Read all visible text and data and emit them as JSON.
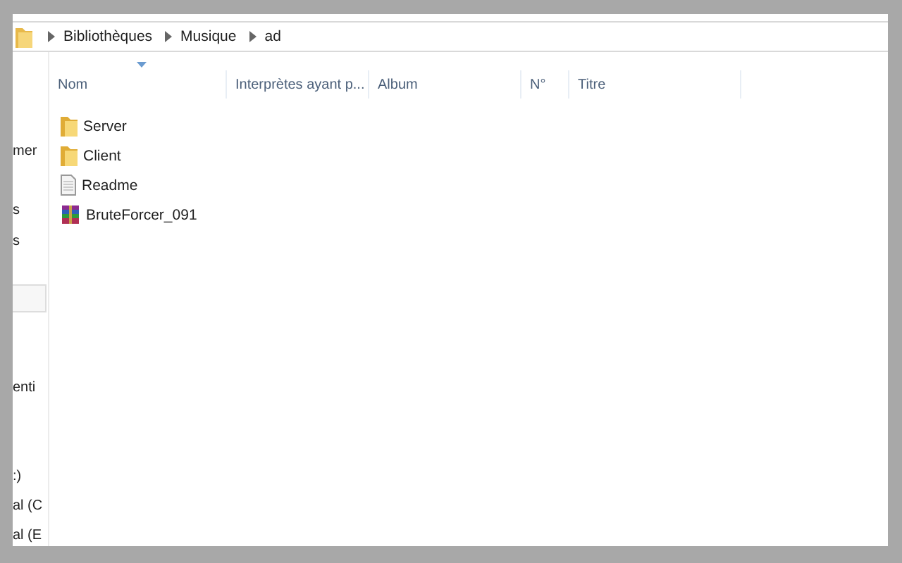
{
  "breadcrumb": [
    "Bibliothèques",
    "Musique",
    "ad"
  ],
  "sidebar": {
    "items": [
      {
        "label": "mer"
      },
      {
        "label": "s"
      },
      {
        "label": "s"
      },
      {
        "label": "enti"
      },
      {
        "label": ":)"
      },
      {
        "label": "al (C"
      },
      {
        "label": "al (E"
      }
    ]
  },
  "table": {
    "columns": [
      {
        "label": "Nom",
        "sorted": true
      },
      {
        "label": "Interprètes ayant p...",
        "sorted": false
      },
      {
        "label": "Album",
        "sorted": false
      },
      {
        "label": "N°",
        "sorted": false
      },
      {
        "label": "Titre",
        "sorted": false
      }
    ],
    "rows": [
      {
        "name": "Server",
        "kind": "folder"
      },
      {
        "name": "Client",
        "kind": "folder"
      },
      {
        "name": "Readme",
        "kind": "text"
      },
      {
        "name": "BruteForcer_091",
        "kind": "archive"
      }
    ]
  }
}
